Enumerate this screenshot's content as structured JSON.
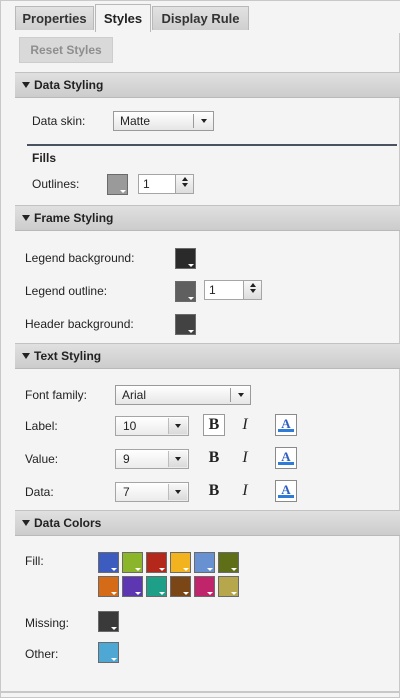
{
  "tabs": {
    "properties": "Properties",
    "styles": "Styles",
    "display_rule": "Display Rule"
  },
  "reset_label": "Reset Styles",
  "data_styling": {
    "title": "Data Styling",
    "skin_label": "Data skin:",
    "skin_value": "Matte",
    "fills_label": "Fills",
    "outlines_label": "Outlines:",
    "outlines_color": "#9a9a9a",
    "outlines_width": "1"
  },
  "frame_styling": {
    "title": "Frame Styling",
    "legend_bg_label": "Legend background:",
    "legend_bg_color": "#2a2a2a",
    "legend_outline_label": "Legend outline:",
    "legend_outline_color": "#5f5f5f",
    "legend_outline_width": "1",
    "header_bg_label": "Header background:",
    "header_bg_color": "#424242"
  },
  "text_styling": {
    "title": "Text Styling",
    "font_family_label": "Font family:",
    "font_family_value": "Arial",
    "rows": [
      {
        "label": "Label:",
        "size": "10",
        "bold": "B",
        "italic": "I",
        "color_glyph": "A"
      },
      {
        "label": "Value:",
        "size": "9",
        "bold": "B",
        "italic": "I",
        "color_glyph": "A"
      },
      {
        "label": "Data:",
        "size": "7",
        "bold": "B",
        "italic": "I",
        "color_glyph": "A"
      }
    ]
  },
  "data_colors": {
    "title": "Data Colors",
    "fill_label": "Fill:",
    "fill_colors": [
      "#3d5cbf",
      "#8bb52a",
      "#b3281b",
      "#f2b31f",
      "#6891d2",
      "#5e6f17",
      "#d56b17",
      "#5d36b1",
      "#1e9f87",
      "#7a4616",
      "#c0246b",
      "#b6a64c"
    ],
    "missing_label": "Missing:",
    "missing_color": "#3a3a3a",
    "other_label": "Other:",
    "other_color": "#4fa8d3"
  }
}
